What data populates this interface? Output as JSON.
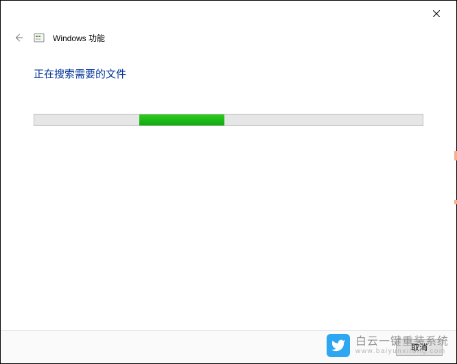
{
  "header": {
    "title": "Windows 功能"
  },
  "content": {
    "status_text": "正在搜索需要的文件",
    "progress": {
      "offset_percent": 27,
      "chunk_percent": 22
    }
  },
  "footer": {
    "cancel_label": "取消"
  },
  "watermark": {
    "line1": "白云一键重装系统",
    "line2": "www.baiyunxitong.com"
  },
  "icons": {
    "close": "close-icon",
    "back": "back-arrow-icon",
    "app": "windows-features-icon",
    "watermark": "bird-icon"
  }
}
